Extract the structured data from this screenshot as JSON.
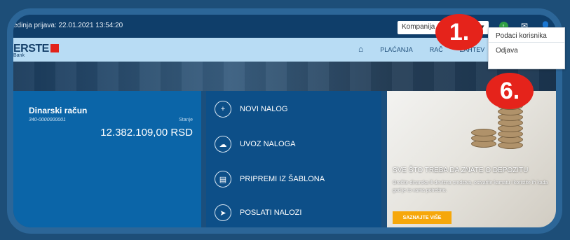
{
  "topbar": {
    "last_login": "edinja prijava: 22.01.2021 13:54:20",
    "company_select_value": "Kompanija",
    "icons": [
      "up-circle-icon",
      "mail-icon",
      "user-icon"
    ]
  },
  "logo": {
    "text": "ERSTE",
    "sub": "Bank"
  },
  "nav": {
    "home_icon": "home-icon",
    "items": [
      "PLAĆANJA",
      "RAČ",
      "ZAHTEV"
    ]
  },
  "account": {
    "title": "Dinarski račun",
    "number": "340-0000000001",
    "balance_label": "Stanje",
    "balance": "12.382.109,00 RSD"
  },
  "actions": [
    {
      "label": "NOVI NALOG",
      "icon": "plus-circle-icon"
    },
    {
      "label": "UVOZ NALOGA",
      "icon": "cloud-upload-icon"
    },
    {
      "label": "PRIPREMI IZ ŠABLONA",
      "icon": "template-icon"
    },
    {
      "label": "POSLATI NALOZI",
      "icon": "send-icon"
    }
  ],
  "promo": {
    "title": "SVE ŠTO TREBA DA ZNATE O DEPOZITU",
    "text": "Oročite dinarska ili devizna sredstva, ostvarite kamatu i koristite ih kada god je to vama potrebno.",
    "button": "SAZNAJTE VIŠE"
  },
  "dropdown": {
    "items": [
      "Podaci korisnika",
      "Odjava"
    ]
  },
  "badges": {
    "first": "1.",
    "second": "6."
  },
  "colors": {
    "accent_red": "#e5231b",
    "promo_button": "#f6a70a",
    "card_blue": "#0b65a8"
  }
}
